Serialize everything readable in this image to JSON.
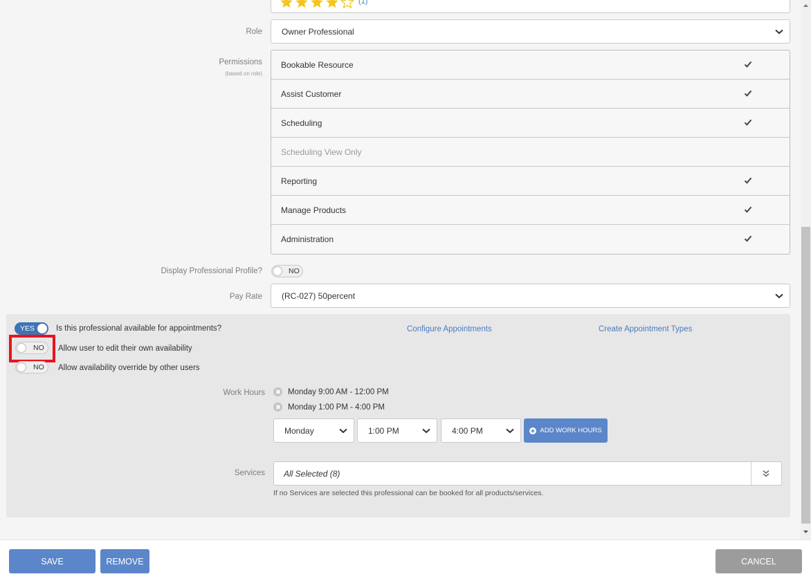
{
  "rating": {
    "value": 4,
    "max": 5,
    "count": "(1)"
  },
  "role": {
    "label": "Role",
    "value": "Owner Professional"
  },
  "permissions": {
    "label": "Permissions",
    "sublabel": "(based on role)",
    "items": [
      {
        "label": "Bookable Resource",
        "checked": true
      },
      {
        "label": "Assist Customer",
        "checked": true
      },
      {
        "label": "Scheduling",
        "checked": true
      },
      {
        "label": "Scheduling View Only",
        "checked": false
      },
      {
        "label": "Reporting",
        "checked": true
      },
      {
        "label": "Manage Products",
        "checked": true
      },
      {
        "label": "Administration",
        "checked": true
      }
    ]
  },
  "display_profile": {
    "label": "Display Professional Profile?",
    "toggle": "NO"
  },
  "pay_rate": {
    "label": "Pay Rate",
    "value": "(RC-027) 50percent"
  },
  "availability": {
    "available_toggle": "YES",
    "available_label": "Is this professional available for appointments?",
    "edit_own_toggle": "NO",
    "edit_own_label": "Allow user to edit their own availability",
    "override_toggle": "NO",
    "override_label": "Allow availability override by other users",
    "configure_link": "Configure Appointments",
    "create_types_link": "Create Appointment Types"
  },
  "work_hours": {
    "label": "Work Hours",
    "entries": [
      "Monday 9:00 AM - 12:00 PM",
      "Monday 1:00 PM - 4:00 PM"
    ],
    "day_select": "Monday",
    "start_select": "1:00 PM",
    "end_select": "4:00 PM",
    "add_button": "ADD WORK HOURS"
  },
  "services": {
    "label": "Services",
    "value": "All Selected (8)",
    "note": "If no Services are selected this professional can be booked for all products/services."
  },
  "footer": {
    "save": "SAVE",
    "remove": "REMOVE",
    "cancel": "CANCEL"
  },
  "colors": {
    "primary": "#5b86c9",
    "toggle_on": "#3c74b6",
    "highlight": "#e8141c",
    "star": "#f5c518"
  }
}
